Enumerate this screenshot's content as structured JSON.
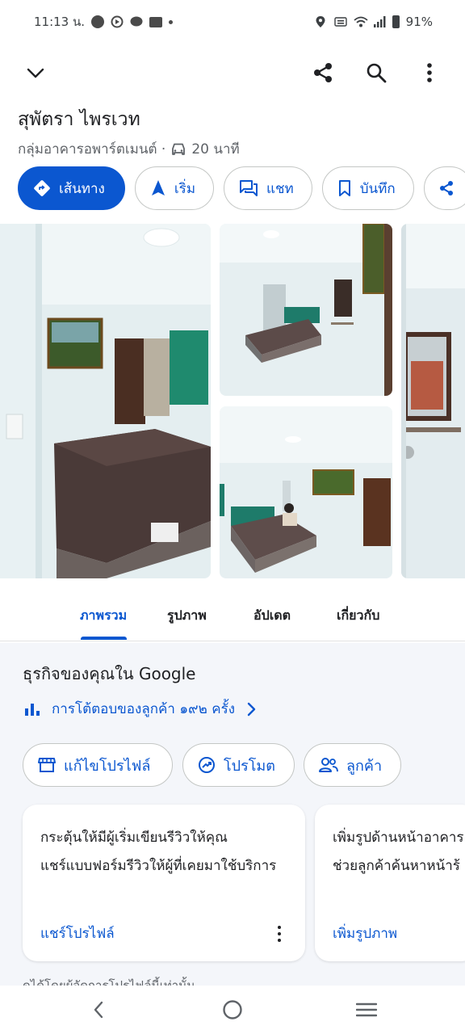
{
  "status_bar": {
    "time": "11:13 น.",
    "battery": "91%"
  },
  "place": {
    "title": "สุพัตรา ไพรเวท",
    "category": "กลุ่มอาคารอพาร์ตเมนต์ ·",
    "drive_time": "20 นาที"
  },
  "actions": [
    {
      "label": "เส้นทาง",
      "icon": "directions-icon"
    },
    {
      "label": "เริ่ม",
      "icon": "navigation-arrow-icon"
    },
    {
      "label": "แชท",
      "icon": "chat-icon"
    },
    {
      "label": "บันทึก",
      "icon": "bookmark-icon"
    }
  ],
  "tabs": [
    "ภาพรวม",
    "รูปภาพ",
    "อัปเดต",
    "เกี่ยวกับ"
  ],
  "business": {
    "title": "ธุรกิจของคุณใน Google",
    "interactions_link": "การโต้ตอบของลูกค้า ๑๙๒ ครั้ง",
    "chips": [
      {
        "label": "แก้ไขโปรไฟล์",
        "icon": "store-icon"
      },
      {
        "label": "โปรโมต",
        "icon": "trending-icon"
      },
      {
        "label": "ลูกค้า",
        "icon": "people-icon"
      }
    ],
    "cards": [
      {
        "line1": "กระตุ้นให้มีผู้เริ่มเขียนรีวิวให้คุณ",
        "line2": "แชร์แบบฟอร์มรีวิวให้ผู้ที่เคยมาใช้บริการ",
        "link": "แชร์โปรไฟล์"
      },
      {
        "line1": "เพิ่มรูปด้านหน้าอาคาร",
        "line2": "ช่วยลูกค้าค้นหาหน้าร้",
        "link": "เพิ่มรูปภาพ"
      }
    ],
    "footer_note": "ดูได้โดยผู้จัดการโปรไฟล์นี้เท่านั้น"
  },
  "colors": {
    "accent": "#0b57d0",
    "section_bg": "#f4f6fa"
  }
}
